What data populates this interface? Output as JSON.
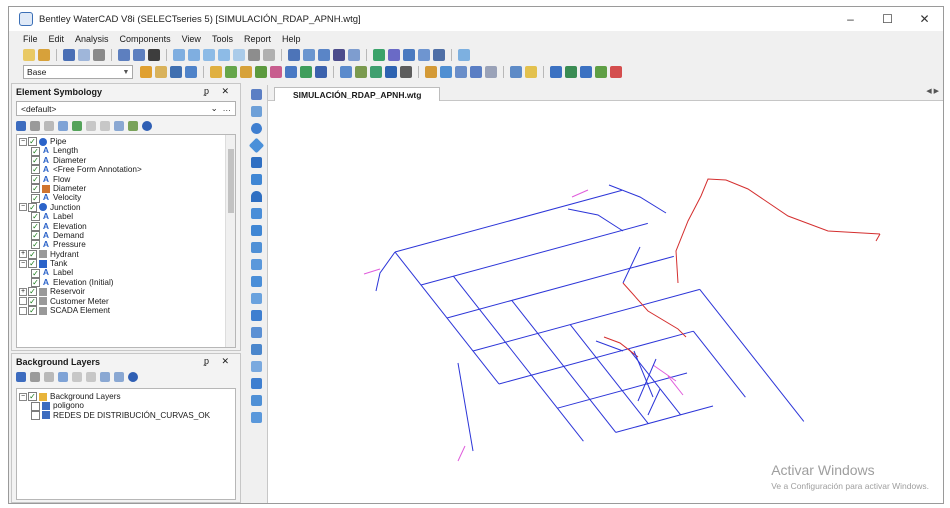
{
  "window": {
    "title": "Bentley WaterCAD V8i (SELECTseries 5) [SIMULACIÓN_RDAP_APNH.wtg]",
    "controls": {
      "minimize": "–",
      "maximize": "☐",
      "close": "✕"
    }
  },
  "menu": [
    "File",
    "Edit",
    "Analysis",
    "Components",
    "View",
    "Tools",
    "Report",
    "Help"
  ],
  "toolbar": {
    "scenario_combo": "Base"
  },
  "element_symbology": {
    "title": "Element Symbology",
    "pin_close": "ᵱ ✕",
    "combo_value": "<default>",
    "tree": [
      {
        "label": "Pipe",
        "level": 0,
        "expander": "−",
        "icon": "pipe-icon"
      },
      {
        "label": "Length",
        "level": 1,
        "icon": "annotation-a-icon"
      },
      {
        "label": "Diameter",
        "level": 1,
        "icon": "annotation-a-icon"
      },
      {
        "label": "<Free Form Annotation>",
        "level": 1,
        "icon": "annotation-a-icon"
      },
      {
        "label": "Flow",
        "level": 1,
        "icon": "annotation-a-icon"
      },
      {
        "label": "Diameter",
        "level": 1,
        "icon": "color-coding-icon"
      },
      {
        "label": "Velocity",
        "level": 1,
        "icon": "annotation-a-icon"
      },
      {
        "label": "Junction",
        "level": 0,
        "expander": "−",
        "icon": "junction-icon"
      },
      {
        "label": "Label",
        "level": 1,
        "icon": "annotation-a-icon"
      },
      {
        "label": "Elevation",
        "level": 1,
        "icon": "annotation-a-icon"
      },
      {
        "label": "Demand",
        "level": 1,
        "icon": "annotation-a-icon"
      },
      {
        "label": "Pressure",
        "level": 1,
        "icon": "annotation-a-icon"
      },
      {
        "label": "Hydrant",
        "level": 0,
        "expander": "+",
        "icon": "hydrant-icon"
      },
      {
        "label": "Tank",
        "level": 0,
        "expander": "−",
        "icon": "tank-icon"
      },
      {
        "label": "Label",
        "level": 1,
        "icon": "annotation-a-icon"
      },
      {
        "label": "Elevation (Initial)",
        "level": 1,
        "icon": "annotation-a-icon"
      },
      {
        "label": "Reservoir",
        "level": 0,
        "expander": "+",
        "icon": "reservoir-icon"
      },
      {
        "label": "Customer Meter",
        "level": 0,
        "expander": "",
        "icon": "customer-meter-icon"
      },
      {
        "label": "SCADA Element",
        "level": 0,
        "expander": "",
        "icon": "scada-icon"
      }
    ]
  },
  "background_layers": {
    "title": "Background Layers",
    "pin_close": "ᵱ ✕",
    "tree": [
      {
        "label": "Background Layers",
        "level": 0,
        "expander": "−",
        "checked": true
      },
      {
        "label": "poligono",
        "level": 1,
        "checked": false
      },
      {
        "label": "REDES DE DISTRIBUCIÓN_CURVAS_OK",
        "level": 1,
        "checked": false
      }
    ]
  },
  "document": {
    "tab": "SIMULACIÓN_RDAP_APNH.wtg",
    "tab_nav": "◀ ▶"
  },
  "network": {
    "colors": {
      "pipes": "#2c35d8",
      "trunk": "#d42f2f",
      "ends": "#e05cdc"
    }
  },
  "activation": {
    "title": "Activar Windows",
    "subtitle": "Ve a Configuración para activar Windows."
  }
}
